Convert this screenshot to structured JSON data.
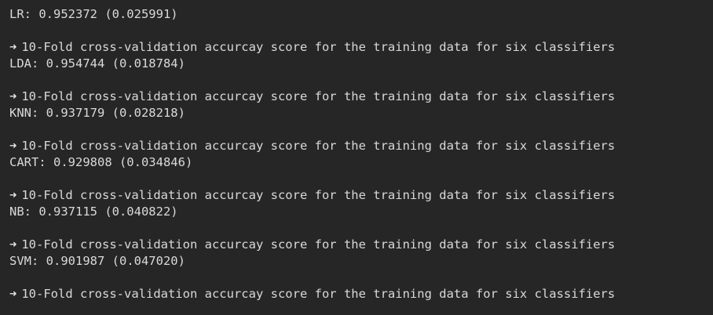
{
  "output": {
    "arrow_symbol": "➜",
    "lines": [
      {
        "kind": "score",
        "text": "LR: 0.952372 (0.025991)"
      },
      {
        "kind": "blank"
      },
      {
        "kind": "header",
        "text": "10-Fold cross-validation accurcay score for the training data for six classifiers"
      },
      {
        "kind": "score",
        "text": "LDA: 0.954744 (0.018784)"
      },
      {
        "kind": "blank"
      },
      {
        "kind": "header",
        "text": "10-Fold cross-validation accurcay score for the training data for six classifiers"
      },
      {
        "kind": "score",
        "text": "KNN: 0.937179 (0.028218)"
      },
      {
        "kind": "blank"
      },
      {
        "kind": "header",
        "text": "10-Fold cross-validation accurcay score for the training data for six classifiers"
      },
      {
        "kind": "score",
        "text": "CART: 0.929808 (0.034846)"
      },
      {
        "kind": "blank"
      },
      {
        "kind": "header",
        "text": "10-Fold cross-validation accurcay score for the training data for six classifiers"
      },
      {
        "kind": "score",
        "text": "NB: 0.937115 (0.040822)"
      },
      {
        "kind": "blank"
      },
      {
        "kind": "header",
        "text": "10-Fold cross-validation accurcay score for the training data for six classifiers"
      },
      {
        "kind": "score",
        "text": "SVM: 0.901987 (0.047020)"
      },
      {
        "kind": "blank"
      },
      {
        "kind": "header",
        "text": "10-Fold cross-validation accurcay score for the training data for six classifiers"
      }
    ]
  }
}
